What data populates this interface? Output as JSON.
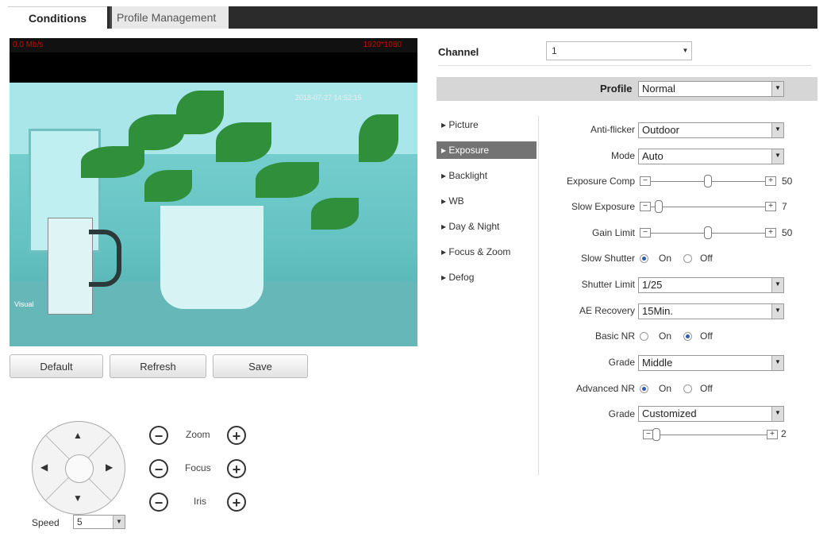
{
  "tabs": {
    "active": "Conditions",
    "inactive": "Profile Management"
  },
  "video": {
    "top_left": "0.0 Mb/s",
    "top_right": "1920*1080",
    "timestamp": "2018-07-27 14:52:15",
    "label": "Visual"
  },
  "buttons": {
    "default": "Default",
    "refresh": "Refresh",
    "save": "Save"
  },
  "ptz": {
    "zoom": "Zoom",
    "focus": "Focus",
    "iris": "Iris",
    "minus": "−",
    "plus": "+",
    "speed_label": "Speed",
    "speed_value": "5"
  },
  "arrows": {
    "up": "▲",
    "down": "▼",
    "left": "◀",
    "right": "▶",
    "dropdown": "▼"
  },
  "channel": {
    "label": "Channel",
    "value": "1"
  },
  "profile": {
    "label": "Profile",
    "value": "Normal"
  },
  "menu": {
    "picture": "▸ Picture",
    "exposure": "▸ Exposure",
    "backlight": "▸ Backlight",
    "wb": "▸ WB",
    "daynight": "▸ Day & Night",
    "focuszoom": "▸ Focus & Zoom",
    "defog": "▸ Defog"
  },
  "exposure": {
    "anti_flicker": {
      "label": "Anti-flicker",
      "value": "Outdoor"
    },
    "mode": {
      "label": "Mode",
      "value": "Auto"
    },
    "exposure_comp": {
      "label": "Exposure Comp",
      "value": "50",
      "level": 0.5
    },
    "slow_exposure": {
      "label": "Slow Exposure",
      "value": "7",
      "level": 0.07
    },
    "gain_limit": {
      "label": "Gain Limit",
      "value": "50",
      "level": 0.5
    },
    "slow_shutter": {
      "label": "Slow Shutter",
      "on": "On",
      "off": "Off",
      "selected": "On"
    },
    "shutter_limit": {
      "label": "Shutter Limit",
      "value": "1/25"
    },
    "ae_recovery": {
      "label": "AE Recovery",
      "value": "15Min."
    },
    "basic_nr": {
      "label": "Basic NR",
      "on": "On",
      "off": "Off",
      "selected": "Off"
    },
    "grade1": {
      "label": "Grade",
      "value": "Middle"
    },
    "advanced_nr": {
      "label": "Advanced NR",
      "on": "On",
      "off": "Off",
      "selected": "On"
    },
    "grade2": {
      "label": "Grade",
      "value": "Customized"
    },
    "nr_level": {
      "value": "2",
      "level": 0.02
    }
  },
  "slider_signs": {
    "minus": "−",
    "plus": "+"
  }
}
